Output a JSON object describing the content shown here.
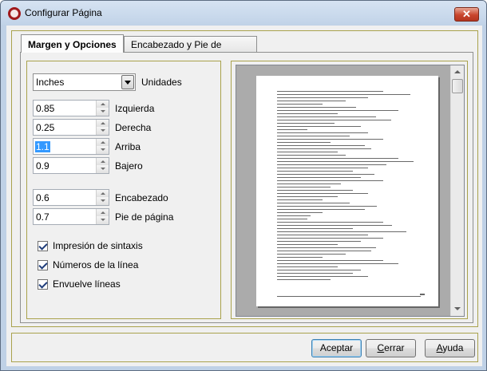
{
  "window": {
    "title": "Configurar Página",
    "close_label": "✕"
  },
  "tabs": [
    {
      "label": "Margen y Opciones",
      "active": true
    },
    {
      "label": "Encabezado y Pie de página",
      "active": false
    }
  ],
  "units": {
    "value": "Inches",
    "label": "Unidades"
  },
  "margins": [
    {
      "value": "0.85",
      "label": "Izquierda"
    },
    {
      "value": "0.25",
      "label": "Derecha"
    },
    {
      "value": "1.1",
      "label": "Arriba",
      "selected": true
    },
    {
      "value": "0.9",
      "label": "Bajero"
    }
  ],
  "header_footer": [
    {
      "value": "0.6",
      "label": "Encabezado"
    },
    {
      "value": "0.7",
      "label": "Pie de página"
    }
  ],
  "options": [
    {
      "label": "Impresión de sintaxis",
      "checked": true
    },
    {
      "label": "Números de la línea",
      "checked": true
    },
    {
      "label": "Envuelve líneas",
      "checked": true
    }
  ],
  "buttons": {
    "accept": "Aceptar",
    "close_prefix": "C",
    "close_rest": "errar",
    "help_prefix": "A",
    "help_rest": "yuda"
  },
  "colors": {
    "accent": "#3399ff",
    "title_bar": "#c1d3e8",
    "frame_border": "#a9a24c"
  }
}
